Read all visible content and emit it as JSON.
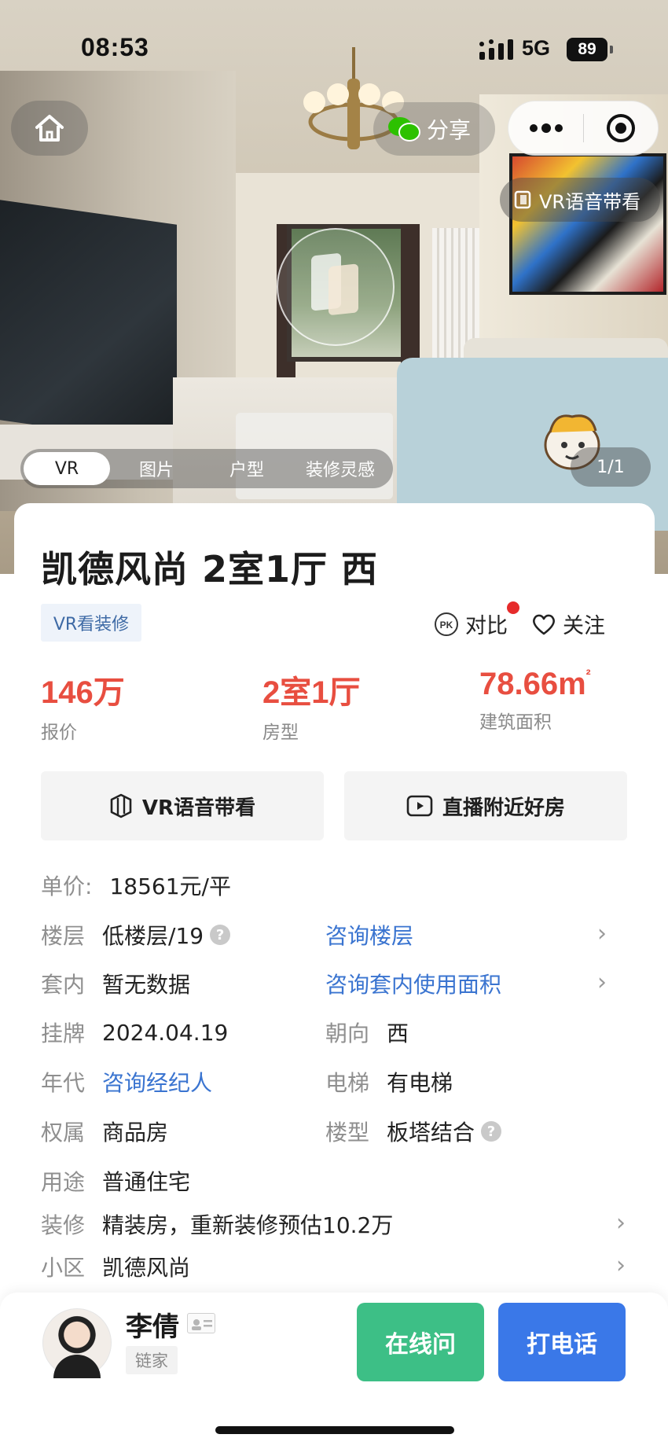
{
  "status_bar": {
    "time": "08:53",
    "network": "5G",
    "battery": "89"
  },
  "top_controls": {
    "share_label": "分享",
    "vr_voice_tag": "VR语音带看"
  },
  "media_tabs": [
    {
      "label": "VR"
    },
    {
      "label": "图片"
    },
    {
      "label": "户型"
    },
    {
      "label": "装修灵感"
    }
  ],
  "media_counter": "1/1",
  "listing": {
    "title": "凯德风尚 2室1厅 西",
    "tag": "VR看装修",
    "compare_label": "对比",
    "follow_label": "关注",
    "metrics": {
      "price_value": "146万",
      "price_label": "报价",
      "layout_value": "2室1厅",
      "layout_label": "房型",
      "area_value": "78.66m",
      "area_sup": "²",
      "area_label": "建筑面积"
    },
    "actions": {
      "vr_voice": "VR语音带看",
      "live": "直播附近好房"
    }
  },
  "details": {
    "unit_price": {
      "k": "单价:",
      "v": "18561元/平"
    },
    "floor": {
      "k": "楼层",
      "v": "低楼层/19",
      "link": "咨询楼层"
    },
    "inner": {
      "k": "套内",
      "v": "暂无数据",
      "link": "咨询套内使用面积"
    },
    "listed": {
      "k": "挂牌",
      "v": "2024.04.19"
    },
    "orientation": {
      "k": "朝向",
      "v": "西"
    },
    "year": {
      "k": "年代",
      "link": "咨询经纪人"
    },
    "elevator": {
      "k": "电梯",
      "v": "有电梯"
    },
    "ownership": {
      "k": "权属",
      "v": "商品房"
    },
    "building_type": {
      "k": "楼型",
      "v": "板塔结合"
    },
    "usage": {
      "k": "用途",
      "v": "普通住宅"
    },
    "decoration": {
      "k": "装修",
      "v": "精装房，重新装修预估10.2万"
    },
    "community": {
      "k": "小区",
      "v": "凯德风尚"
    }
  },
  "agent": {
    "name": "李倩",
    "company": "链家"
  },
  "bottom_actions": {
    "chat": "在线问",
    "call": "打电话"
  },
  "colors": {
    "price_red": "#e84e40",
    "link_blue": "#3a74d0",
    "chat_green": "#3dbf86",
    "call_blue": "#3a78e8"
  }
}
